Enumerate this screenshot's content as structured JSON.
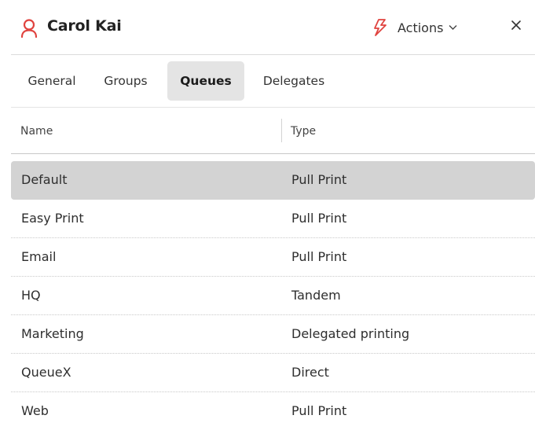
{
  "header": {
    "title": "Carol Kai",
    "user_icon": "person-icon",
    "actions_label": "Actions",
    "actions_icon": "lightning-bolt-icon",
    "close_icon": "close-icon",
    "accent_color": "#e0433f"
  },
  "tabs": [
    {
      "label": "General",
      "active": false
    },
    {
      "label": "Groups",
      "active": false
    },
    {
      "label": "Queues",
      "active": true
    },
    {
      "label": "Delegates",
      "active": false
    }
  ],
  "table": {
    "columns": [
      "Name",
      "Type"
    ],
    "rows": [
      {
        "name": "Default",
        "type": "Pull Print",
        "selected": true
      },
      {
        "name": "Easy Print",
        "type": "Pull Print",
        "selected": false
      },
      {
        "name": "Email",
        "type": "Pull Print",
        "selected": false
      },
      {
        "name": "HQ",
        "type": "Tandem",
        "selected": false
      },
      {
        "name": "Marketing",
        "type": "Delegated printing",
        "selected": false
      },
      {
        "name": "QueueX",
        "type": "Direct",
        "selected": false
      },
      {
        "name": "Web",
        "type": "Pull Print",
        "selected": false
      }
    ]
  }
}
